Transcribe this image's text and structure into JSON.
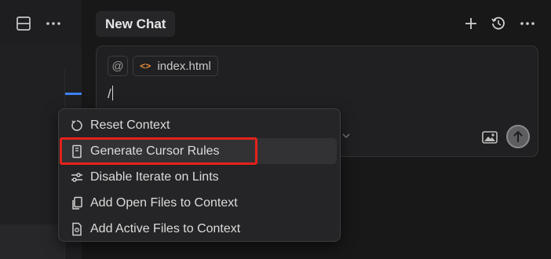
{
  "left_toolbar": {
    "icons": [
      "layout-panel-icon",
      "more-icon"
    ]
  },
  "chat": {
    "tab_title": "New Chat",
    "header_icons": [
      "new-chat-icon",
      "history-icon",
      "more-icon"
    ]
  },
  "composer": {
    "mention_symbol": "@",
    "context_file": "index.html",
    "typed_text": "/"
  },
  "slash_menu": {
    "items": [
      {
        "label": "Reset Context",
        "icon": "reset-icon"
      },
      {
        "label": "Generate Cursor Rules",
        "icon": "rules-book-icon"
      },
      {
        "label": "Disable Iterate on Lints",
        "icon": "sliders-icon"
      },
      {
        "label": "Add Open Files to Context",
        "icon": "files-icon"
      },
      {
        "label": "Add Active Files to Context",
        "icon": "active-file-icon"
      }
    ],
    "hovered_index": 1
  },
  "colors": {
    "highlight_border": "#e5221c",
    "accent_blue": "#3b82f6",
    "file_icon": "#e08a3a"
  }
}
